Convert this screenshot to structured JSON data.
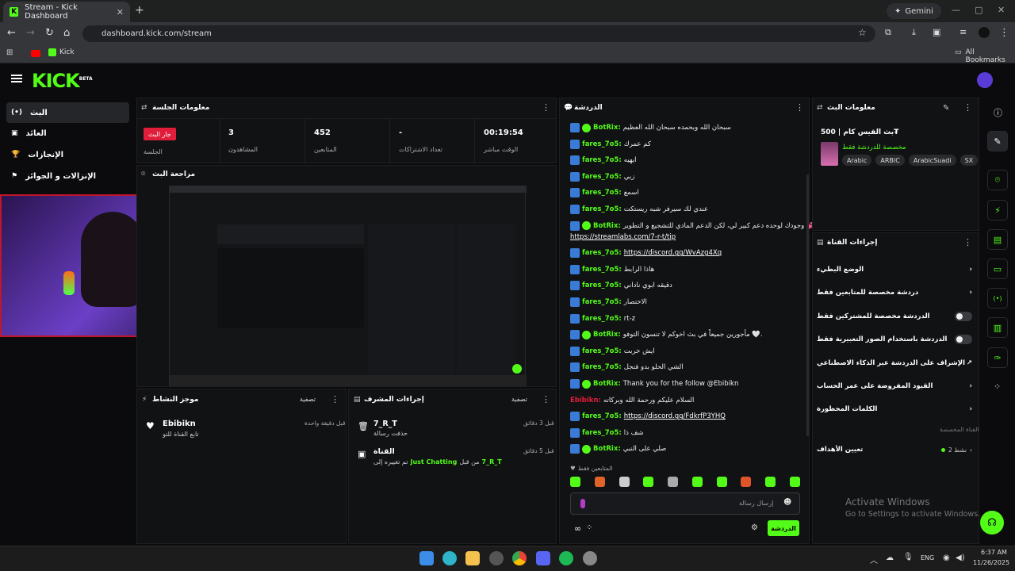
{
  "browser": {
    "tab_title": "Stream - Kick Dashboard",
    "url": "dashboard.kick.com/stream",
    "gemini_label": "Gemini",
    "bookmark_kick": "Kick",
    "all_bookmarks": "All Bookmarks"
  },
  "header": {
    "logo": "KICK",
    "beta": "BETA"
  },
  "sidebar": {
    "items": [
      {
        "label": "البث",
        "icon": "broadcast-icon"
      },
      {
        "label": "العائد",
        "icon": "money-icon"
      },
      {
        "label": "الإنجازات",
        "icon": "trophy-icon"
      },
      {
        "label": "الإنزالات و الجوائز",
        "icon": "gift-icon"
      }
    ]
  },
  "session": {
    "title": "معلومات الجلسة",
    "live_badge": "جار البث",
    "live_label": "الجلسة",
    "viewers_value": "3",
    "viewers_label": "المشاهدون",
    "followers_value": "452",
    "followers_label": "المتابعين",
    "subs_value": "-",
    "subs_label": "تعداد الاشتراكات",
    "time_value": "00:19:54",
    "time_label": "الوقت مباشر"
  },
  "preview": {
    "title": "مراجعة البث"
  },
  "activity": {
    "title": "موجز النشاط",
    "filter": "تصفية",
    "item_user": "Ebibikn",
    "item_desc": "تابع القناة للتو",
    "item_time": "قبل دقيقة واحدة"
  },
  "modactions": {
    "title": "إجراءات المشرف",
    "filter": "تصفية",
    "item1_user": "7_R_T",
    "item1_desc": "حذفت رسالة",
    "item1_time": "قبل 3 دقائق",
    "item2_title": "القناة",
    "item2_desc_pre": "تم تغييره إلى",
    "item2_desc_cat": "Just Chatting",
    "item2_desc_mid": "من قبل",
    "item2_desc_user": "7_R_T",
    "item2_time": "قبل 5 دقائق"
  },
  "chat": {
    "title": "الدردشة",
    "messages": [
      {
        "user": "BotRix:",
        "text": "سبحان الله وبحمده سبحان الله العظيم",
        "verified": true
      },
      {
        "user": "fares_7o5:",
        "text": "كم عمرك"
      },
      {
        "user": "fares_7o5:",
        "text": "ايهيه"
      },
      {
        "user": "fares_7o5:",
        "text": "زبي"
      },
      {
        "user": "fares_7o5:",
        "text": "اسمع"
      },
      {
        "user": "fares_7o5:",
        "text": "عندي لك سيرفر شبه ريستكت"
      },
      {
        "user": "BotRix:",
        "text": "وجودك لوحده دعم كبير لي، لكن الدعم المادي للتشجيع و التطوير 💕",
        "verified": true
      },
      {
        "user": "",
        "text": "https://streamlabs.com/7-r-t/tip",
        "link": true
      },
      {
        "user": "fares_7o5:",
        "text": "https://discord.gg/WvAzg4Xq",
        "link": true
      },
      {
        "user": "fares_7o5:",
        "text": "هاذا الرابط"
      },
      {
        "user": "fares_7o5:",
        "text": "دقيقه ابوي ناداني"
      },
      {
        "user": "fares_7o5:",
        "text": "الاختصار"
      },
      {
        "user": "fares_7o5:",
        "text": "rt-z"
      },
      {
        "user": "BotRix:",
        "text": "مأجورين جميعاً في بث اخوكم لا تنسون التوفو 🤍.",
        "verified": true
      },
      {
        "user": "fares_7o5:",
        "text": "ايش خربت"
      },
      {
        "user": "fares_7o5:",
        "text": "الشي الحلو بدو فنجل"
      },
      {
        "user": "BotRix:",
        "text": "Thank you for the follow @Ebibikn",
        "verified": true
      },
      {
        "user": "Ebibikn:",
        "text": "السلام عليكم ورحمة الله وبركاته",
        "red": true
      },
      {
        "user": "fares_7o5:",
        "text": "https://discord.gg/FdkrfP3YHQ",
        "link": true
      },
      {
        "user": "fares_7o5:",
        "text": "شف ذا"
      },
      {
        "user": "BotRix:",
        "text": "صلي على النبي",
        "verified": true
      }
    ],
    "followers_only": "المتابعين فقط",
    "input_placeholder": "إرسال رسالة",
    "send_button": "الدردشة"
  },
  "streaminfo": {
    "title": "معلومات البث",
    "stream_title": "بث القيس كام | 500₮",
    "category": "مخصصة للدردشة فقط",
    "tags": [
      "Arabic",
      "ARBIC",
      "ArabicSuadi",
      "SX"
    ]
  },
  "channelactions": {
    "title": "إجراءات القناة",
    "rows": [
      "الوضع البطيء",
      "دردشة مخصصة للمتابعين فقط",
      "الدردشة مخصصة للمشتركين فقط",
      "الدردشة باستخدام الصور التعبيرية فقط",
      "الإشراف على الدردشة عبر الذكاء الاصطناعي",
      "القيود المفروضة على عمر الحساب",
      "الكلمات المحظورة"
    ],
    "custom_label": "القناة المخصصة",
    "goals_label": "تعيين الأهداف",
    "goals_status": "نشط 2"
  },
  "watermark": {
    "line1": "Activate Windows",
    "line2": "Go to Settings to activate Windows."
  },
  "taskbar": {
    "lang": "ENG",
    "time": "6:37 AM",
    "date": "11/26/2025"
  },
  "colors": {
    "accent": "#53fc18",
    "live": "#e01e3c"
  }
}
